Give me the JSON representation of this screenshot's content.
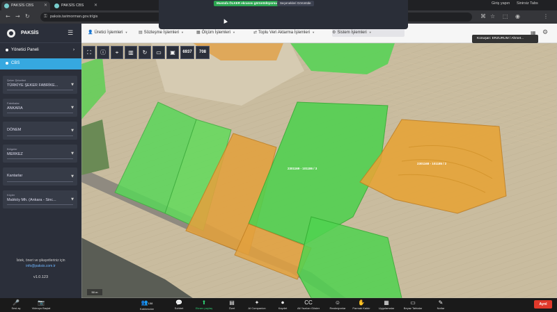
{
  "browser": {
    "tabs": [
      {
        "label": "PAKSİS CBS",
        "left": 1
      },
      {
        "label": "PAKSİS CBS",
        "left": 1
      }
    ],
    "url": "paksis.tarimorman.gov.tr/gis",
    "profile_label": "Giriş yapın",
    "menu_label": "Sinirsiz Tabs"
  },
  "zoom_share": {
    "sharing_text": "Mustafa ÖLKER ekranını görüntülüyorsunuz",
    "view_options": "Seçenekleri Görüntüle"
  },
  "app": {
    "brand": "PAKSİS",
    "nav": {
      "panel_label": "Yönetici Paneli",
      "cbs_label": "CBS"
    },
    "filters": [
      {
        "label": "Şeker Şirketleri",
        "value": "TÜRKİYE ŞEKER FABRİKE..."
      },
      {
        "label": "Fabrikalar",
        "value": "ANKARA"
      },
      {
        "label": "",
        "value": "DÖNEM"
      },
      {
        "label": "Bölgeler",
        "value": "MERKEZ"
      },
      {
        "label": "",
        "value": "Kantarlar"
      },
      {
        "label": "Köyler",
        "value": "Malıköy Mh. (Ankara - Sinc..."
      }
    ],
    "footer": {
      "line1": "İstek, öneri ve şikayetleriniz için",
      "mail": "info@paksis.com.tr",
      "version": "v1.0.123"
    }
  },
  "topmenu": {
    "items": [
      "Üretici İşlemleri",
      "Sözleşme İşlemleri",
      "Ölçüm İşlemleri",
      "Toplu Veri Aktarma İşlemleri",
      "Sistem İşlemleri"
    ],
    "tooltip": "Konuşan: ERZURUM / Ahmet..."
  },
  "map": {
    "toolbar_count_1": "6937",
    "toolbar_count_2": "708",
    "parcel_labels": [
      "2301169 - 101186 / 3",
      "2301168 - 101185 / 2"
    ],
    "scale": "50 m",
    "colors": {
      "green_parcel": "#4cd64c",
      "orange_parcel": "#e8a030",
      "ground": "#c9bc9f"
    }
  },
  "zoombar": {
    "items": [
      {
        "label": "Sesi aç",
        "glyph": "🎤"
      },
      {
        "label": "Videoyu Başlat",
        "glyph": "📷"
      },
      {
        "label": "Katılımcılar",
        "glyph": "👥"
      },
      {
        "label": "Sohbet",
        "glyph": "💬"
      },
      {
        "label": "Ekranı paylaş",
        "glyph": "⬆"
      },
      {
        "label": "Özet",
        "glyph": "▤"
      },
      {
        "label": "AI Companion",
        "glyph": "✦"
      },
      {
        "label": "Kaydet",
        "glyph": "⏺"
      },
      {
        "label": "Alt Yazıları Göster",
        "glyph": "CC"
      },
      {
        "label": "Reaksiyonlar",
        "glyph": "☺"
      },
      {
        "label": "Parmak Kaldır",
        "glyph": "✋"
      },
      {
        "label": "Uygulamalar",
        "glyph": "▦"
      },
      {
        "label": "Beyaz Tahtalar",
        "glyph": "▭"
      },
      {
        "label": "Notlar",
        "glyph": "✎"
      }
    ],
    "participant_count": "158",
    "end_label": "Ayrıl"
  }
}
